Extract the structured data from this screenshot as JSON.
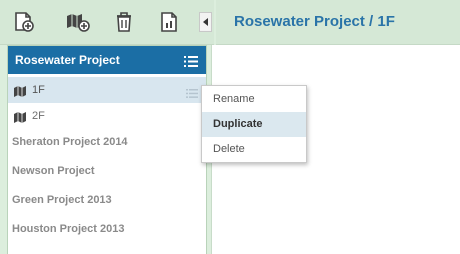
{
  "header": {
    "title": "Rosewater Project / 1F"
  },
  "sidebar": {
    "project_title": "Rosewater Project",
    "floors": [
      {
        "label": "1F",
        "active": true
      },
      {
        "label": "2F",
        "active": false
      }
    ],
    "projects": [
      {
        "label": "Sheraton Project 2014"
      },
      {
        "label": "Newson Project"
      },
      {
        "label": "Green Project 2013"
      },
      {
        "label": "Houston Project 2013"
      }
    ]
  },
  "context_menu": {
    "items": [
      {
        "label": "Rename"
      },
      {
        "label": "Duplicate",
        "highlighted": true
      },
      {
        "label": "Delete"
      }
    ]
  },
  "colors": {
    "accent": "#1b6ea5",
    "title": "#2a74a8",
    "toolbar": "#d5e8d6"
  }
}
